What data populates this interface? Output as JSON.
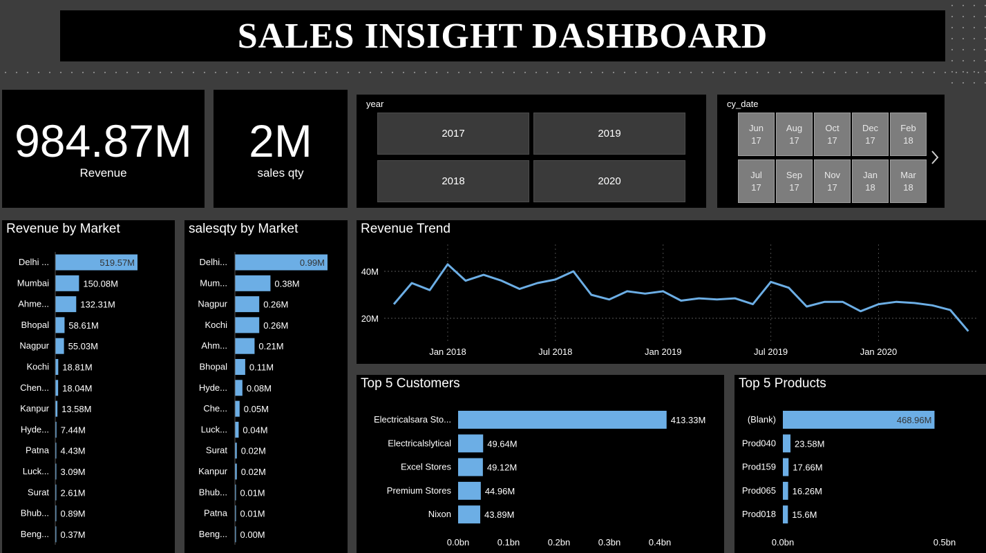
{
  "header": {
    "title": "SALES INSIGHT DASHBOARD"
  },
  "kpis": {
    "revenue": {
      "value": "984.87M",
      "label": "Revenue"
    },
    "sales_qty": {
      "value": "2M",
      "label": "sales qty"
    }
  },
  "year_slicer": {
    "title": "year",
    "options": [
      "2017",
      "2019",
      "2018",
      "2020"
    ]
  },
  "date_slicer": {
    "title": "cy_date",
    "options": [
      {
        "month": "Jun",
        "year": "17"
      },
      {
        "month": "Aug",
        "year": "17"
      },
      {
        "month": "Oct",
        "year": "17"
      },
      {
        "month": "Dec",
        "year": "17"
      },
      {
        "month": "Feb",
        "year": "18"
      },
      {
        "month": "Jul",
        "year": "17"
      },
      {
        "month": "Sep",
        "year": "17"
      },
      {
        "month": "Nov",
        "year": "17"
      },
      {
        "month": "Jan",
        "year": "18"
      },
      {
        "month": "Mar",
        "year": "18"
      }
    ],
    "next_icon": "chevron-right-icon"
  },
  "colors": {
    "bar": "#6CAEE5",
    "line": "#6CAEE5",
    "panel": "#000000",
    "background": "#3d3d3d"
  },
  "chart_data": [
    {
      "id": "revenue_by_market",
      "type": "bar",
      "orientation": "horizontal",
      "title": "Revenue by Market",
      "categories": [
        "Delhi ...",
        "Mumbai",
        "Ahme...",
        "Bhopal",
        "Nagpur",
        "Kochi",
        "Chen...",
        "Kanpur",
        "Hyde...",
        "Patna",
        "Luck...",
        "Surat",
        "Bhub...",
        "Beng..."
      ],
      "values": [
        519.57,
        150.08,
        132.31,
        58.61,
        55.03,
        18.81,
        18.04,
        13.58,
        7.44,
        4.43,
        3.09,
        2.61,
        0.89,
        0.37
      ],
      "data_labels": [
        "519.57M",
        "150.08M",
        "132.31M",
        "58.61M",
        "55.03M",
        "18.81M",
        "18.04M",
        "13.58M",
        "7.44M",
        "4.43M",
        "3.09M",
        "2.61M",
        "0.89M",
        "0.37M"
      ],
      "unit": "M"
    },
    {
      "id": "salesqty_by_market",
      "type": "bar",
      "orientation": "horizontal",
      "title": "salesqty by Market",
      "categories": [
        "Delhi...",
        "Mum...",
        "Nagpur",
        "Kochi",
        "Ahm...",
        "Bhopal",
        "Hyde...",
        "Che...",
        "Luck...",
        "Surat",
        "Kanpur",
        "Bhub...",
        "Patna",
        "Beng..."
      ],
      "values": [
        0.99,
        0.38,
        0.26,
        0.26,
        0.21,
        0.11,
        0.08,
        0.05,
        0.04,
        0.02,
        0.02,
        0.01,
        0.01,
        0.0
      ],
      "data_labels": [
        "0.99M",
        "0.38M",
        "0.26M",
        "0.26M",
        "0.21M",
        "0.11M",
        "0.08M",
        "0.05M",
        "0.04M",
        "0.02M",
        "0.02M",
        "0.01M",
        "0.01M",
        "0.00M"
      ],
      "unit": "M"
    },
    {
      "id": "revenue_trend",
      "type": "line",
      "title": "Revenue Trend",
      "x": [
        "2017-10",
        "2017-11",
        "2017-12",
        "2018-01",
        "2018-02",
        "2018-03",
        "2018-04",
        "2018-05",
        "2018-06",
        "2018-07",
        "2018-08",
        "2018-09",
        "2018-10",
        "2018-11",
        "2018-12",
        "2019-01",
        "2019-02",
        "2019-03",
        "2019-04",
        "2019-05",
        "2019-06",
        "2019-07",
        "2019-08",
        "2019-09",
        "2019-10",
        "2019-11",
        "2019-12",
        "2020-01",
        "2020-02",
        "2020-03",
        "2020-04",
        "2020-05",
        "2020-06"
      ],
      "y": [
        26,
        35,
        32,
        43,
        36,
        38.5,
        36,
        32.5,
        35,
        36.5,
        40,
        30,
        28,
        31.5,
        30.5,
        31.5,
        27.5,
        28.5,
        28,
        28.5,
        26,
        35.5,
        33,
        25,
        27,
        27,
        23,
        26,
        27,
        26.5,
        25.5,
        23.5,
        14.5
      ],
      "y_unit": "M",
      "y_ticks": [
        "20M",
        "40M"
      ],
      "x_ticks": [
        "Jan 2018",
        "Jul 2018",
        "Jan 2019",
        "Jul 2019",
        "Jan 2020"
      ],
      "grid": true
    },
    {
      "id": "top5_customers",
      "type": "bar",
      "orientation": "horizontal",
      "title": "Top 5 Customers",
      "categories": [
        "Electricalsara Sto...",
        "Electricalslytical",
        "Excel Stores",
        "Premium Stores",
        "Nixon"
      ],
      "values": [
        0.41333,
        0.04964,
        0.04912,
        0.04496,
        0.04389
      ],
      "data_labels": [
        "413.33M",
        "49.64M",
        "49.12M",
        "44.96M",
        "43.89M"
      ],
      "x_ticks": [
        "0.0bn",
        "0.1bn",
        "0.2bn",
        "0.3bn",
        "0.4bn"
      ],
      "x_tick_values": [
        0,
        0.1,
        0.2,
        0.3,
        0.4
      ],
      "unit": "bn"
    },
    {
      "id": "top5_products",
      "type": "bar",
      "orientation": "horizontal",
      "title": "Top 5 Products",
      "categories": [
        "(Blank)",
        "Prod040",
        "Prod159",
        "Prod065",
        "Prod018"
      ],
      "values": [
        0.46896,
        0.02358,
        0.01766,
        0.01626,
        0.0156
      ],
      "data_labels": [
        "468.96M",
        "23.58M",
        "17.66M",
        "16.26M",
        "15.6M"
      ],
      "x_ticks": [
        "0.0bn",
        "0.5bn"
      ],
      "x_tick_values": [
        0,
        0.5
      ],
      "unit": "bn"
    }
  ]
}
